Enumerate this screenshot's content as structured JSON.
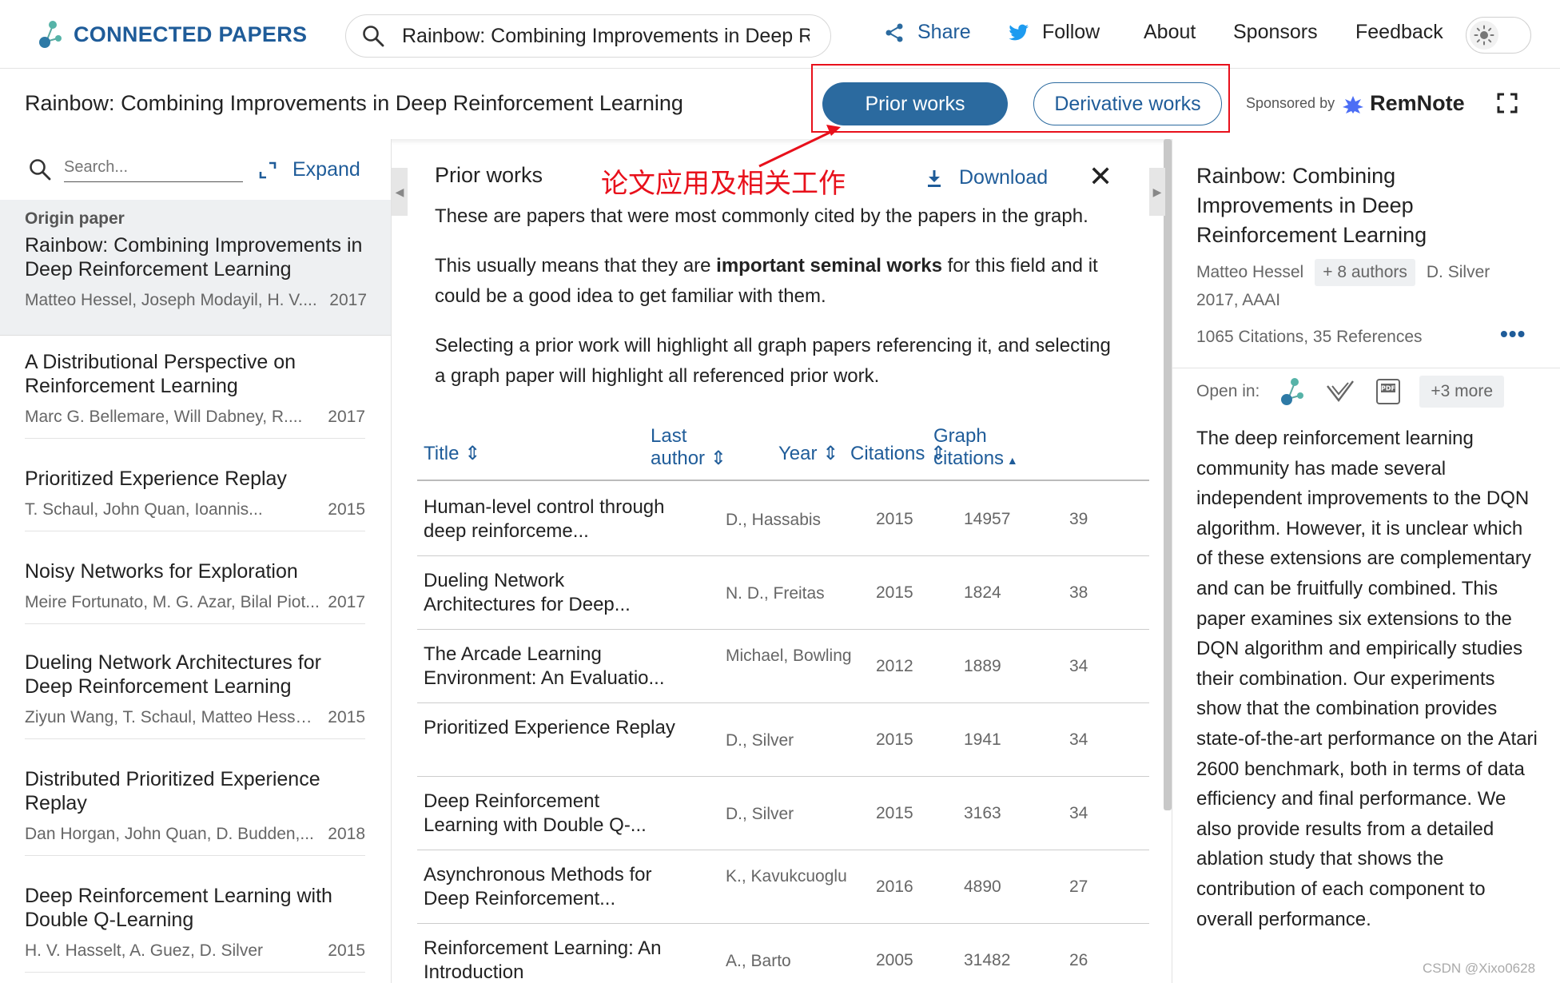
{
  "header": {
    "logo_text": "CONNECTED PAPERS",
    "search_value": "Rainbow: Combining Improvements in Deep R",
    "nav": {
      "share": "Share",
      "follow": "Follow",
      "about": "About",
      "sponsors": "Sponsors",
      "feedback": "Feedback"
    }
  },
  "subheader": {
    "paper_title": "Rainbow: Combining Improvements in Deep Reinforcement Learning",
    "prior_works": "Prior works",
    "derivative_works": "Derivative works",
    "sponsored_by": "Sponsored by",
    "sponsor_brand": "RemNote"
  },
  "left": {
    "search_placeholder": "Search...",
    "expand": "Expand",
    "origin": {
      "tag": "Origin paper",
      "title": "Rainbow: Combining Improvements in Deep Reinforcement Learning",
      "authors": "Matteo Hessel, Joseph Modayil, H. V....",
      "year": "2017"
    },
    "items": [
      {
        "title": "A Distributional Perspective on Reinforcement Learning",
        "authors": "Marc G. Bellemare, Will Dabney, R....",
        "year": "2017"
      },
      {
        "title": "Prioritized Experience Replay",
        "authors": "T. Schaul, John Quan, Ioannis...",
        "year": "2015"
      },
      {
        "title": "Noisy Networks for Exploration",
        "authors": "Meire Fortunato, M. G. Azar, Bilal Piot...",
        "year": "2017"
      },
      {
        "title": "Dueling Network Architectures for Deep Reinforcement Learning",
        "authors": "Ziyun Wang, T. Schaul, Matteo Hessel...",
        "year": "2015"
      },
      {
        "title": "Distributed Prioritized Experience Replay",
        "authors": "Dan Horgan, John Quan, D. Budden,...",
        "year": "2018"
      },
      {
        "title": "Deep Reinforcement Learning with Double Q-Learning",
        "authors": "H. V. Hasselt, A. Guez, D. Silver",
        "year": "2015"
      }
    ]
  },
  "center": {
    "heading": "Prior works",
    "annotation": "论文应用及相关工作",
    "download": "Download",
    "p1": "These are papers that were most commonly cited by the papers in the graph.",
    "p2_a": "This usually means that they are ",
    "p2_b": "important seminal works",
    "p2_c": " for this field and it could be a good idea to get familiar with them.",
    "p3": "Selecting a prior work will highlight all graph papers referencing it, and selecting a graph paper will highlight all referenced prior work.",
    "columns": {
      "title": "Title",
      "last_author_1": "Last",
      "last_author_2": "author",
      "year": "Year",
      "citations": "Citations",
      "graph_1": "Graph",
      "graph_2": "citations"
    },
    "rows": [
      {
        "title": "Human-level control through deep reinforceme...",
        "author": "D., Hassabis",
        "year": "2015",
        "citations": "14957",
        "graph": "39"
      },
      {
        "title": "Dueling Network Architectures for Deep...",
        "author": "N. D., Freitas",
        "year": "2015",
        "citations": "1824",
        "graph": "38"
      },
      {
        "title": "The Arcade Learning Environment: An Evaluatio...",
        "author": "Michael, Bowling",
        "year": "2012",
        "citations": "1889",
        "graph": "34"
      },
      {
        "title": "Prioritized Experience Replay",
        "author": "D., Silver",
        "year": "2015",
        "citations": "1941",
        "graph": "34"
      },
      {
        "title": "Deep Reinforcement Learning with Double Q-...",
        "author": "D., Silver",
        "year": "2015",
        "citations": "3163",
        "graph": "34"
      },
      {
        "title": "Asynchronous Methods for Deep Reinforcement...",
        "author": "K., Kavukcuoglu",
        "year": "2016",
        "citations": "4890",
        "graph": "27"
      },
      {
        "title": "Reinforcement Learning: An Introduction",
        "author": "A., Barto",
        "year": "2005",
        "citations": "31482",
        "graph": "26"
      }
    ]
  },
  "right": {
    "title": "Rainbow: Combining Improvements in Deep Reinforcement Learning",
    "first_author": "Matteo Hessel",
    "more_authors": "+ 8 authors",
    "last_author": "D. Silver",
    "year_venue": "2017, AAAI",
    "citations": "1065 Citations, 35 References",
    "open_in": "Open in:",
    "more": "+3 more",
    "abstract": "The deep reinforcement learning community has made several independent improvements to the DQN algorithm. However, it is unclear which of these extensions are complementary and can be fruitfully combined. This paper examines six extensions to the DQN algorithm and empirically studies their combination. Our experiments show that the combination provides state-of-the-art performance on the Atari 2600 benchmark, both in terms of data efficiency and final performance. We also provide results from a detailed ablation study that shows the contribution of each component to overall performance."
  },
  "watermark": "CSDN @Xixo0628",
  "colors": {
    "brand": "#1f5c99",
    "primary_button": "#2b6a9f",
    "annotation_red": "#e8101b"
  }
}
